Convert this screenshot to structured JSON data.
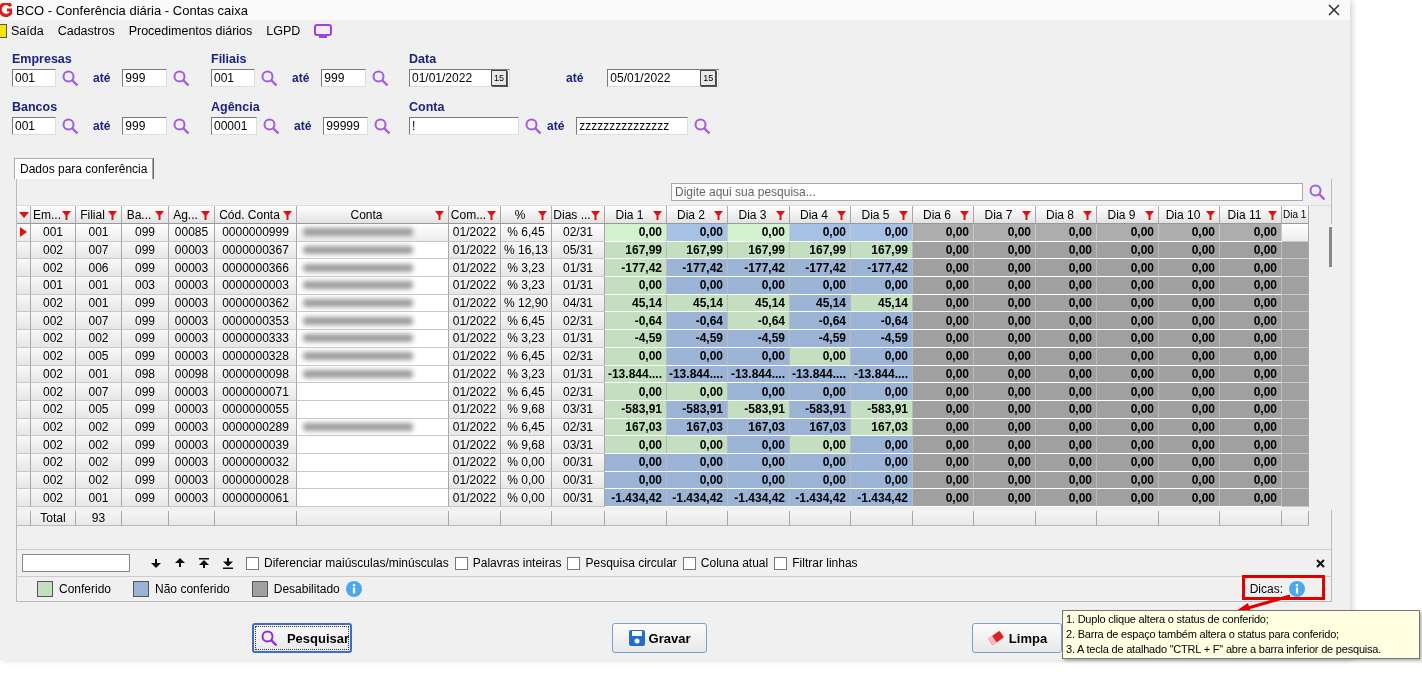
{
  "window": {
    "title": "BCO - Conferência diária - Contas caixa"
  },
  "menu": [
    {
      "label": "Saída"
    },
    {
      "label": "Cadastros"
    },
    {
      "label": "Procedimentos diários"
    },
    {
      "label": "LGPD"
    }
  ],
  "filters": [
    {
      "label": "Empresas",
      "kind": "range",
      "from": "001",
      "to_label": "até",
      "to": "999"
    },
    {
      "label": "Filiais",
      "kind": "range",
      "from": "001",
      "to_label": "até",
      "to": "999"
    },
    {
      "label": "Data",
      "kind": "date",
      "from": "01/01/2022",
      "from_calendar": "15",
      "to_label": "até",
      "to": "05/01/2022",
      "to_calendar": "15"
    },
    {
      "label": "Bancos",
      "kind": "range",
      "from": "001",
      "to_label": "até",
      "to": "999"
    },
    {
      "label": "Agência",
      "kind": "range",
      "from": "00001",
      "to_label": "até",
      "to": "99999"
    },
    {
      "label": "Conta",
      "kind": "wide",
      "from": "!",
      "to_label": "até",
      "to": "zzzzzzzzzzzzzzz"
    }
  ],
  "tabs": [
    {
      "label": "Dados para conferência",
      "selected": true
    }
  ],
  "grid_search": {
    "placeholder": "Digite aqui sua pesquisa..."
  },
  "columns": [
    {
      "label": "Em..."
    },
    {
      "label": "Filial"
    },
    {
      "label": "Ba..."
    },
    {
      "label": "Ag..."
    },
    {
      "label": "Cód. Conta"
    },
    {
      "label": "Conta"
    },
    {
      "label": "Com..."
    },
    {
      "label": "%"
    },
    {
      "label": "Dias ..."
    },
    {
      "label": "Dia 1"
    },
    {
      "label": "Dia 2"
    },
    {
      "label": "Dia 3"
    },
    {
      "label": "Dia 4"
    },
    {
      "label": "Dia 5"
    },
    {
      "label": "Dia 6"
    },
    {
      "label": "Dia 7"
    },
    {
      "label": "Dia 8"
    },
    {
      "label": "Dia 9"
    },
    {
      "label": "Dia 10"
    },
    {
      "label": "Dia 11"
    },
    {
      "label": "Dia 1"
    }
  ],
  "rows": [
    {
      "selected": true,
      "cells": [
        "001",
        "001",
        "099",
        "00085",
        "0000000999"
      ],
      "conta_blurred": true,
      "cells2": [
        "01/2022",
        "% 6,45",
        "02/31"
      ],
      "days": [
        {
          "value": "0,00",
          "checked": true,
          "disabled": false
        },
        {
          "value": "0,00",
          "checked": false,
          "disabled": false
        },
        {
          "value": "0,00",
          "checked": true,
          "disabled": false
        },
        {
          "value": "0,00",
          "checked": false,
          "disabled": false
        },
        {
          "value": "0,00",
          "checked": false,
          "disabled": false
        },
        {
          "value": "0,00",
          "checked": false,
          "disabled": true
        },
        {
          "value": "0,00",
          "checked": false,
          "disabled": true
        },
        {
          "value": "0,00",
          "checked": false,
          "disabled": true
        },
        {
          "value": "0,00",
          "checked": false,
          "disabled": true
        },
        {
          "value": "0,00",
          "checked": false,
          "disabled": true
        },
        {
          "value": "0,00",
          "checked": false,
          "disabled": true
        }
      ]
    },
    {
      "selected": false,
      "cells": [
        "002",
        "007",
        "099",
        "00003",
        "0000000367"
      ],
      "conta_blurred": true,
      "cells2": [
        "01/2022",
        "% 16,13",
        "05/31"
      ],
      "days": [
        {
          "value": "167,99",
          "checked": true,
          "disabled": false
        },
        {
          "value": "167,99",
          "checked": true,
          "disabled": false
        },
        {
          "value": "167,99",
          "checked": true,
          "disabled": false
        },
        {
          "value": "167,99",
          "checked": true,
          "disabled": false
        },
        {
          "value": "167,99",
          "checked": true,
          "disabled": false
        },
        {
          "value": "0,00",
          "checked": false,
          "disabled": true
        },
        {
          "value": "0,00",
          "checked": false,
          "disabled": true
        },
        {
          "value": "0,00",
          "checked": false,
          "disabled": true
        },
        {
          "value": "0,00",
          "checked": false,
          "disabled": true
        },
        {
          "value": "0,00",
          "checked": false,
          "disabled": true
        },
        {
          "value": "0,00",
          "checked": false,
          "disabled": true
        }
      ]
    },
    {
      "selected": false,
      "cells": [
        "002",
        "006",
        "099",
        "00003",
        "0000000366"
      ],
      "conta_blurred": true,
      "cells2": [
        "01/2022",
        "% 3,23",
        "01/31"
      ],
      "days": [
        {
          "value": "-177,42",
          "checked": true,
          "disabled": false
        },
        {
          "value": "-177,42",
          "checked": false,
          "disabled": false
        },
        {
          "value": "-177,42",
          "checked": false,
          "disabled": false
        },
        {
          "value": "-177,42",
          "checked": false,
          "disabled": false
        },
        {
          "value": "-177,42",
          "checked": false,
          "disabled": false
        },
        {
          "value": "0,00",
          "checked": false,
          "disabled": true
        },
        {
          "value": "0,00",
          "checked": false,
          "disabled": true
        },
        {
          "value": "0,00",
          "checked": false,
          "disabled": true
        },
        {
          "value": "0,00",
          "checked": false,
          "disabled": true
        },
        {
          "value": "0,00",
          "checked": false,
          "disabled": true
        },
        {
          "value": "0,00",
          "checked": false,
          "disabled": true
        }
      ]
    },
    {
      "selected": false,
      "cells": [
        "001",
        "001",
        "003",
        "00003",
        "0000000003"
      ],
      "conta_blurred": true,
      "cells2": [
        "01/2022",
        "% 3,23",
        "01/31"
      ],
      "days": [
        {
          "value": "0,00",
          "checked": true,
          "disabled": false
        },
        {
          "value": "0,00",
          "checked": false,
          "disabled": false
        },
        {
          "value": "0,00",
          "checked": false,
          "disabled": false
        },
        {
          "value": "0,00",
          "checked": false,
          "disabled": false
        },
        {
          "value": "0,00",
          "checked": false,
          "disabled": false
        },
        {
          "value": "0,00",
          "checked": false,
          "disabled": true
        },
        {
          "value": "0,00",
          "checked": false,
          "disabled": true
        },
        {
          "value": "0,00",
          "checked": false,
          "disabled": true
        },
        {
          "value": "0,00",
          "checked": false,
          "disabled": true
        },
        {
          "value": "0,00",
          "checked": false,
          "disabled": true
        },
        {
          "value": "0,00",
          "checked": false,
          "disabled": true
        }
      ]
    },
    {
      "selected": false,
      "cells": [
        "002",
        "001",
        "099",
        "00003",
        "0000000362"
      ],
      "conta_blurred": true,
      "cells2": [
        "01/2022",
        "% 12,90",
        "04/31"
      ],
      "days": [
        {
          "value": "45,14",
          "checked": true,
          "disabled": false
        },
        {
          "value": "45,14",
          "checked": true,
          "disabled": false
        },
        {
          "value": "45,14",
          "checked": true,
          "disabled": false
        },
        {
          "value": "45,14",
          "checked": false,
          "disabled": false
        },
        {
          "value": "45,14",
          "checked": true,
          "disabled": false
        },
        {
          "value": "0,00",
          "checked": false,
          "disabled": true
        },
        {
          "value": "0,00",
          "checked": false,
          "disabled": true
        },
        {
          "value": "0,00",
          "checked": false,
          "disabled": true
        },
        {
          "value": "0,00",
          "checked": false,
          "disabled": true
        },
        {
          "value": "0,00",
          "checked": false,
          "disabled": true
        },
        {
          "value": "0,00",
          "checked": false,
          "disabled": true
        }
      ]
    },
    {
      "selected": false,
      "cells": [
        "002",
        "007",
        "099",
        "00003",
        "0000000353"
      ],
      "conta_blurred": true,
      "cells2": [
        "01/2022",
        "% 6,45",
        "02/31"
      ],
      "days": [
        {
          "value": "-0,64",
          "checked": true,
          "disabled": false
        },
        {
          "value": "-0,64",
          "checked": false,
          "disabled": false
        },
        {
          "value": "-0,64",
          "checked": true,
          "disabled": false
        },
        {
          "value": "-0,64",
          "checked": false,
          "disabled": false
        },
        {
          "value": "-0,64",
          "checked": false,
          "disabled": false
        },
        {
          "value": "0,00",
          "checked": false,
          "disabled": true
        },
        {
          "value": "0,00",
          "checked": false,
          "disabled": true
        },
        {
          "value": "0,00",
          "checked": false,
          "disabled": true
        },
        {
          "value": "0,00",
          "checked": false,
          "disabled": true
        },
        {
          "value": "0,00",
          "checked": false,
          "disabled": true
        },
        {
          "value": "0,00",
          "checked": false,
          "disabled": true
        }
      ]
    },
    {
      "selected": false,
      "cells": [
        "002",
        "002",
        "099",
        "00003",
        "0000000333"
      ],
      "conta_blurred": true,
      "cells2": [
        "01/2022",
        "% 3,23",
        "01/31"
      ],
      "days": [
        {
          "value": "-4,59",
          "checked": true,
          "disabled": false
        },
        {
          "value": "-4,59",
          "checked": false,
          "disabled": false
        },
        {
          "value": "-4,59",
          "checked": false,
          "disabled": false
        },
        {
          "value": "-4,59",
          "checked": false,
          "disabled": false
        },
        {
          "value": "-4,59",
          "checked": false,
          "disabled": false
        },
        {
          "value": "0,00",
          "checked": false,
          "disabled": true
        },
        {
          "value": "0,00",
          "checked": false,
          "disabled": true
        },
        {
          "value": "0,00",
          "checked": false,
          "disabled": true
        },
        {
          "value": "0,00",
          "checked": false,
          "disabled": true
        },
        {
          "value": "0,00",
          "checked": false,
          "disabled": true
        },
        {
          "value": "0,00",
          "checked": false,
          "disabled": true
        }
      ]
    },
    {
      "selected": false,
      "cells": [
        "002",
        "005",
        "099",
        "00003",
        "0000000328"
      ],
      "conta_blurred": true,
      "cells2": [
        "01/2022",
        "% 6,45",
        "02/31"
      ],
      "days": [
        {
          "value": "0,00",
          "checked": true,
          "disabled": false
        },
        {
          "value": "0,00",
          "checked": false,
          "disabled": false
        },
        {
          "value": "0,00",
          "checked": false,
          "disabled": false
        },
        {
          "value": "0,00",
          "checked": true,
          "disabled": false
        },
        {
          "value": "0,00",
          "checked": false,
          "disabled": false
        },
        {
          "value": "0,00",
          "checked": false,
          "disabled": true
        },
        {
          "value": "0,00",
          "checked": false,
          "disabled": true
        },
        {
          "value": "0,00",
          "checked": false,
          "disabled": true
        },
        {
          "value": "0,00",
          "checked": false,
          "disabled": true
        },
        {
          "value": "0,00",
          "checked": false,
          "disabled": true
        },
        {
          "value": "0,00",
          "checked": false,
          "disabled": true
        }
      ]
    },
    {
      "selected": false,
      "cells": [
        "002",
        "001",
        "098",
        "00098",
        "0000000098"
      ],
      "conta_blurred": true,
      "cells2": [
        "01/2022",
        "% 3,23",
        "01/31"
      ],
      "days": [
        {
          "value": "-13.844....",
          "checked": true,
          "disabled": false
        },
        {
          "value": "-13.844....",
          "checked": false,
          "disabled": false
        },
        {
          "value": "-13.844....",
          "checked": false,
          "disabled": false
        },
        {
          "value": "-13.844....",
          "checked": false,
          "disabled": false
        },
        {
          "value": "-13.844....",
          "checked": false,
          "disabled": false
        },
        {
          "value": "0,00",
          "checked": false,
          "disabled": true
        },
        {
          "value": "0,00",
          "checked": false,
          "disabled": true
        },
        {
          "value": "0,00",
          "checked": false,
          "disabled": true
        },
        {
          "value": "0,00",
          "checked": false,
          "disabled": true
        },
        {
          "value": "0,00",
          "checked": false,
          "disabled": true
        },
        {
          "value": "0,00",
          "checked": false,
          "disabled": true
        }
      ]
    },
    {
      "selected": false,
      "cells": [
        "002",
        "007",
        "099",
        "00003",
        "0000000071"
      ],
      "conta_blurred": false,
      "cells2": [
        "01/2022",
        "% 6,45",
        "02/31"
      ],
      "days": [
        {
          "value": "0,00",
          "checked": true,
          "disabled": false
        },
        {
          "value": "0,00",
          "checked": true,
          "disabled": false
        },
        {
          "value": "0,00",
          "checked": false,
          "disabled": false
        },
        {
          "value": "0,00",
          "checked": false,
          "disabled": false
        },
        {
          "value": "0,00",
          "checked": false,
          "disabled": false
        },
        {
          "value": "0,00",
          "checked": false,
          "disabled": true
        },
        {
          "value": "0,00",
          "checked": false,
          "disabled": true
        },
        {
          "value": "0,00",
          "checked": false,
          "disabled": true
        },
        {
          "value": "0,00",
          "checked": false,
          "disabled": true
        },
        {
          "value": "0,00",
          "checked": false,
          "disabled": true
        },
        {
          "value": "0,00",
          "checked": false,
          "disabled": true
        }
      ]
    },
    {
      "selected": false,
      "cells": [
        "002",
        "005",
        "099",
        "00003",
        "0000000055"
      ],
      "conta_blurred": false,
      "cells2": [
        "01/2022",
        "% 9,68",
        "03/31"
      ],
      "days": [
        {
          "value": "-583,91",
          "checked": true,
          "disabled": false
        },
        {
          "value": "-583,91",
          "checked": false,
          "disabled": false
        },
        {
          "value": "-583,91",
          "checked": true,
          "disabled": false
        },
        {
          "value": "-583,91",
          "checked": false,
          "disabled": false
        },
        {
          "value": "-583,91",
          "checked": true,
          "disabled": false
        },
        {
          "value": "0,00",
          "checked": false,
          "disabled": true
        },
        {
          "value": "0,00",
          "checked": false,
          "disabled": true
        },
        {
          "value": "0,00",
          "checked": false,
          "disabled": true
        },
        {
          "value": "0,00",
          "checked": false,
          "disabled": true
        },
        {
          "value": "0,00",
          "checked": false,
          "disabled": true
        },
        {
          "value": "0,00",
          "checked": false,
          "disabled": true
        }
      ]
    },
    {
      "selected": false,
      "cells": [
        "002",
        "002",
        "099",
        "00003",
        "0000000289"
      ],
      "conta_blurred": true,
      "cells2": [
        "01/2022",
        "% 6,45",
        "02/31"
      ],
      "days": [
        {
          "value": "167,03",
          "checked": true,
          "disabled": false
        },
        {
          "value": "167,03",
          "checked": false,
          "disabled": false
        },
        {
          "value": "167,03",
          "checked": false,
          "disabled": false
        },
        {
          "value": "167,03",
          "checked": false,
          "disabled": false
        },
        {
          "value": "167,03",
          "checked": true,
          "disabled": false
        },
        {
          "value": "0,00",
          "checked": false,
          "disabled": true
        },
        {
          "value": "0,00",
          "checked": false,
          "disabled": true
        },
        {
          "value": "0,00",
          "checked": false,
          "disabled": true
        },
        {
          "value": "0,00",
          "checked": false,
          "disabled": true
        },
        {
          "value": "0,00",
          "checked": false,
          "disabled": true
        },
        {
          "value": "0,00",
          "checked": false,
          "disabled": true
        }
      ]
    },
    {
      "selected": false,
      "cells": [
        "002",
        "002",
        "099",
        "00003",
        "0000000039"
      ],
      "conta_blurred": false,
      "cells2": [
        "01/2022",
        "% 9,68",
        "03/31"
      ],
      "days": [
        {
          "value": "0,00",
          "checked": true,
          "disabled": false
        },
        {
          "value": "0,00",
          "checked": true,
          "disabled": false
        },
        {
          "value": "0,00",
          "checked": false,
          "disabled": false
        },
        {
          "value": "0,00",
          "checked": true,
          "disabled": false
        },
        {
          "value": "0,00",
          "checked": false,
          "disabled": false
        },
        {
          "value": "0,00",
          "checked": false,
          "disabled": true
        },
        {
          "value": "0,00",
          "checked": false,
          "disabled": true
        },
        {
          "value": "0,00",
          "checked": false,
          "disabled": true
        },
        {
          "value": "0,00",
          "checked": false,
          "disabled": true
        },
        {
          "value": "0,00",
          "checked": false,
          "disabled": true
        },
        {
          "value": "0,00",
          "checked": false,
          "disabled": true
        }
      ]
    },
    {
      "selected": false,
      "cells": [
        "002",
        "002",
        "099",
        "00003",
        "0000000032"
      ],
      "conta_blurred": false,
      "cells2": [
        "01/2022",
        "% 0,00",
        "00/31"
      ],
      "days": [
        {
          "value": "0,00",
          "checked": false,
          "disabled": false
        },
        {
          "value": "0,00",
          "checked": false,
          "disabled": false
        },
        {
          "value": "0,00",
          "checked": false,
          "disabled": false
        },
        {
          "value": "0,00",
          "checked": false,
          "disabled": false
        },
        {
          "value": "0,00",
          "checked": false,
          "disabled": false
        },
        {
          "value": "0,00",
          "checked": false,
          "disabled": true
        },
        {
          "value": "0,00",
          "checked": false,
          "disabled": true
        },
        {
          "value": "0,00",
          "checked": false,
          "disabled": true
        },
        {
          "value": "0,00",
          "checked": false,
          "disabled": true
        },
        {
          "value": "0,00",
          "checked": false,
          "disabled": true
        },
        {
          "value": "0,00",
          "checked": false,
          "disabled": true
        }
      ]
    },
    {
      "selected": false,
      "cells": [
        "002",
        "002",
        "099",
        "00003",
        "0000000028"
      ],
      "conta_blurred": false,
      "cells2": [
        "01/2022",
        "% 0,00",
        "00/31"
      ],
      "days": [
        {
          "value": "0,00",
          "checked": false,
          "disabled": false
        },
        {
          "value": "0,00",
          "checked": false,
          "disabled": false
        },
        {
          "value": "0,00",
          "checked": false,
          "disabled": false
        },
        {
          "value": "0,00",
          "checked": false,
          "disabled": false
        },
        {
          "value": "0,00",
          "checked": false,
          "disabled": false
        },
        {
          "value": "0,00",
          "checked": false,
          "disabled": true
        },
        {
          "value": "0,00",
          "checked": false,
          "disabled": true
        },
        {
          "value": "0,00",
          "checked": false,
          "disabled": true
        },
        {
          "value": "0,00",
          "checked": false,
          "disabled": true
        },
        {
          "value": "0,00",
          "checked": false,
          "disabled": true
        },
        {
          "value": "0,00",
          "checked": false,
          "disabled": true
        }
      ]
    },
    {
      "selected": false,
      "cells": [
        "002",
        "001",
        "099",
        "00003",
        "0000000061"
      ],
      "conta_blurred": false,
      "cells2": [
        "01/2022",
        "% 0,00",
        "00/31"
      ],
      "days": [
        {
          "value": "-1.434,42",
          "checked": false,
          "disabled": false
        },
        {
          "value": "-1.434,42",
          "checked": false,
          "disabled": false
        },
        {
          "value": "-1.434,42",
          "checked": false,
          "disabled": false
        },
        {
          "value": "-1.434,42",
          "checked": false,
          "disabled": false
        },
        {
          "value": "-1.434,42",
          "checked": false,
          "disabled": false
        },
        {
          "value": "0,00",
          "checked": false,
          "disabled": true
        },
        {
          "value": "0,00",
          "checked": false,
          "disabled": true
        },
        {
          "value": "0,00",
          "checked": false,
          "disabled": true
        },
        {
          "value": "0,00",
          "checked": false,
          "disabled": true
        },
        {
          "value": "0,00",
          "checked": false,
          "disabled": true
        },
        {
          "value": "0,00",
          "checked": false,
          "disabled": true
        }
      ]
    }
  ],
  "totals": {
    "label": "Total",
    "count": "93"
  },
  "find_bar": {
    "options": [
      {
        "label": "Diferenciar maiúsculas/minúsculas",
        "checked": false
      },
      {
        "label": "Palavras inteiras",
        "checked": false
      },
      {
        "label": "Pesquisa circular",
        "checked": false
      },
      {
        "label": "Coluna atual",
        "checked": false
      },
      {
        "label": "Filtrar linhas",
        "checked": false
      }
    ]
  },
  "legend": [
    {
      "label": "Conferido",
      "color": "#c3dfc0"
    },
    {
      "label": "Não conferido",
      "color": "#9bb3d4"
    },
    {
      "label": "Desabilitado",
      "color": "#a0a0a0"
    }
  ],
  "tips": {
    "label": "Dicas:",
    "lines": [
      "1. Duplo clique altera o status de conferido;",
      "2. Barra de espaço também altera o status para conferido;",
      "3. A tecla de atalhado \"CTRL + F\" abre a barra inferior de pesquisa."
    ]
  },
  "buttons": [
    {
      "label": "Pesquisar",
      "kind": "search",
      "focused": true
    },
    {
      "label": "Gravar",
      "kind": "save",
      "focused": false
    },
    {
      "label": "Limpa",
      "kind": "clear",
      "focused": false
    }
  ]
}
